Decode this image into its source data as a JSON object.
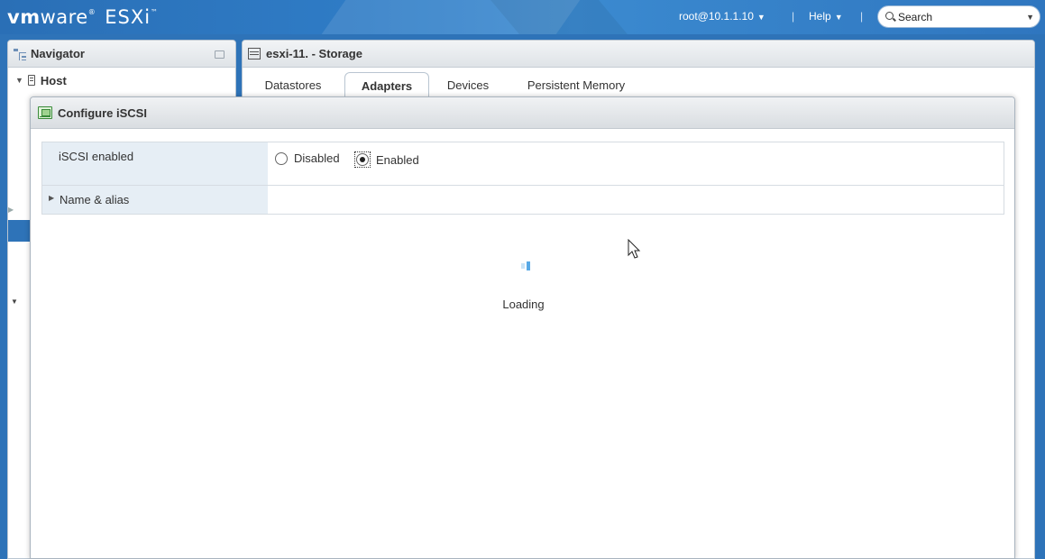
{
  "brand": {
    "vm": "vm",
    "ware": "ware",
    "registered": "®",
    "product": "ESXi",
    "trademark": "™"
  },
  "header": {
    "user": "root@10.1.1.10",
    "separator": "|",
    "help": "Help",
    "search_placeholder": "Search"
  },
  "navigator": {
    "title": "Navigator",
    "host_label": "Host"
  },
  "main": {
    "title": "esxi-11. - Storage",
    "tabs": [
      {
        "label": "Datastores",
        "active": false
      },
      {
        "label": "Adapters",
        "active": true
      },
      {
        "label": "Devices",
        "active": false
      },
      {
        "label": "Persistent Memory",
        "active": false
      }
    ]
  },
  "dialog": {
    "title": "Configure iSCSI",
    "rows": {
      "iscsi_enabled": {
        "label": "iSCSI enabled",
        "options": [
          "Disabled",
          "Enabled"
        ],
        "selected": "Enabled"
      },
      "name_alias": {
        "label": "Name & alias",
        "expanded": false
      }
    },
    "loading_text": "Loading"
  },
  "colors": {
    "banner": "#2e73b8",
    "label_bg": "#e6eef5",
    "spinner_accent": "#58a9e6"
  }
}
